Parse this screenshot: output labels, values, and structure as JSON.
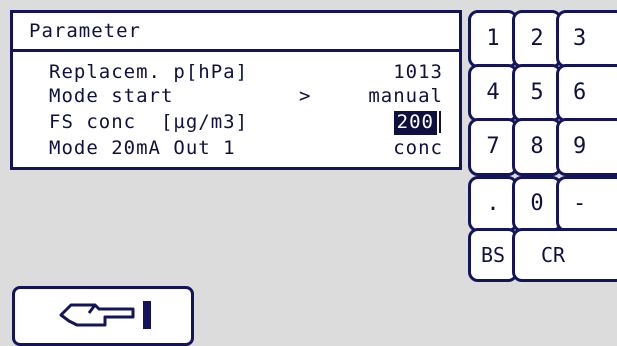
{
  "panel": {
    "title": "Parameter",
    "rows": [
      {
        "label": "Replacem. p[hPa]",
        "arrow": "",
        "value": "1013"
      },
      {
        "label": "Mode start",
        "arrow": ">",
        "value": "manual"
      },
      {
        "label": "FS conc  [µg/m3]",
        "arrow": "",
        "value": "200"
      },
      {
        "label": "Mode 20mA Out 1",
        "arrow": "",
        "value": "conc"
      }
    ]
  },
  "keypad": {
    "keys": [
      "1",
      "2",
      "3",
      "4",
      "5",
      "6",
      "7",
      "8",
      "9",
      ".",
      "0",
      "-",
      "BS",
      "CR"
    ]
  },
  "hand_button": {
    "icon": "pointing-hand-icon"
  },
  "colors": {
    "frame": "#14145a",
    "background": "#dcdcdc",
    "panel": "#ffffff",
    "text": "#101040"
  }
}
